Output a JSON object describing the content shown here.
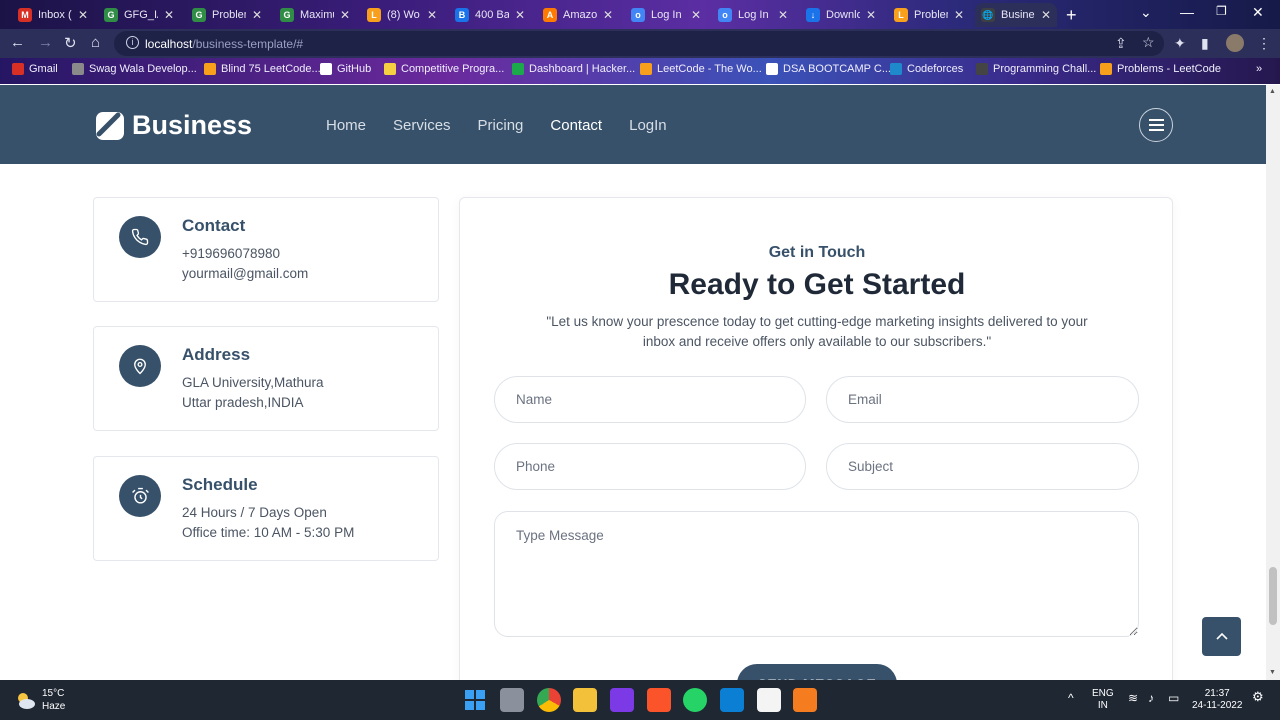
{
  "browser": {
    "tabs": [
      {
        "title": "Inbox (",
        "fav": "M",
        "color": "#d93025"
      },
      {
        "title": "GFG_IA",
        "fav": "G",
        "color": "#2f8d46"
      },
      {
        "title": "Problem",
        "fav": "G",
        "color": "#2f8d46"
      },
      {
        "title": "Maximu",
        "fav": "G",
        "color": "#2f8d46"
      },
      {
        "title": "(8) Wo",
        "fav": "L",
        "color": "#f89f1b"
      },
      {
        "title": "400 Ba",
        "fav": "B",
        "color": "#1a73e8"
      },
      {
        "title": "Amazo",
        "fav": "A",
        "color": "#ff7a00"
      },
      {
        "title": "Log In",
        "fav": "o",
        "color": "#4285f4"
      },
      {
        "title": "Log In",
        "fav": "o",
        "color": "#4285f4"
      },
      {
        "title": "Downlo",
        "fav": "↓",
        "color": "#1a73e8"
      },
      {
        "title": "Problem",
        "fav": "L",
        "color": "#f89f1b"
      },
      {
        "title": "Busines",
        "fav": "🌐",
        "color": "#3c4043"
      }
    ],
    "url_host": "localhost",
    "url_path": "/business-template/#",
    "bookmarks": [
      {
        "label": "Gmail",
        "color": "#d93025"
      },
      {
        "label": "Swag Wala Develop...",
        "color": "#8a8a8a"
      },
      {
        "label": "Blind 75 LeetCode...",
        "color": "#f89f1b"
      },
      {
        "label": "GitHub",
        "color": "#ffffff"
      },
      {
        "label": "Competitive Progra...",
        "color": "#f5d142"
      },
      {
        "label": "Dashboard | Hacker...",
        "color": "#1ba94c"
      },
      {
        "label": "LeetCode - The Wo...",
        "color": "#f89f1b"
      },
      {
        "label": "DSA BOOTCAMP C...",
        "color": "#ffffff"
      },
      {
        "label": "Codeforces",
        "color": "#1f8acb"
      },
      {
        "label": "Programming Chall...",
        "color": "#444444"
      },
      {
        "label": "Problems - LeetCode",
        "color": "#f89f1b"
      }
    ]
  },
  "site": {
    "brand": "Business",
    "nav": [
      "Home",
      "Services",
      "Pricing",
      "Contact",
      "LogIn"
    ],
    "active_nav": "Contact"
  },
  "cards": [
    {
      "title": "Contact",
      "line1": "+919696078980",
      "line2": "yourmail@gmail.com",
      "icon": "phone-icon"
    },
    {
      "title": "Address",
      "line1": "GLA University,Mathura",
      "line2": "Uttar pradesh,INDIA",
      "icon": "location-pin-icon"
    },
    {
      "title": "Schedule",
      "line1": "24 Hours / 7 Days Open",
      "line2": "Office time: 10 AM - 5:30 PM",
      "icon": "alarm-clock-icon"
    }
  ],
  "form": {
    "eyebrow": "Get in Touch",
    "heading": "Ready to Get Started",
    "description": "\"Let us know your prescence today to get cutting-edge marketing insights delivered to your inbox and receive offers only available to our subscribers.\"",
    "name_placeholder": "Name",
    "email_placeholder": "Email",
    "phone_placeholder": "Phone",
    "subject_placeholder": "Subject",
    "message_placeholder": "Type Message",
    "send_label": "SEND MESSAGE"
  },
  "taskbar": {
    "temperature": "15°C",
    "weather": "Haze",
    "lang1": "ENG",
    "lang2": "IN",
    "time": "21:37",
    "date": "24-11-2022"
  },
  "colors": {
    "primary": "#37516a",
    "heading": "#1f2937",
    "text": "#4b5563"
  }
}
